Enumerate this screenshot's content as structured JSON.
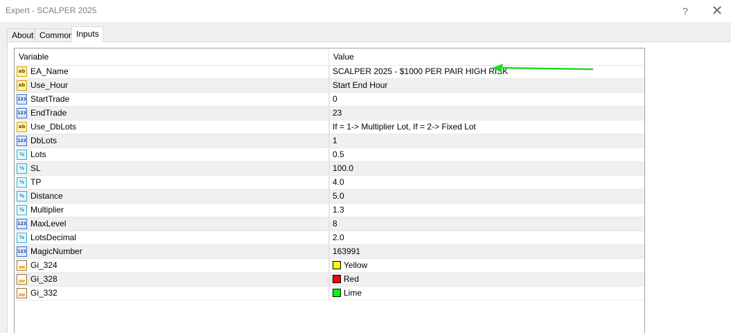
{
  "window": {
    "title": "Expert - SCALPER 2025",
    "help_label": "?",
    "close_label": "✕"
  },
  "tabs": [
    {
      "label": "About"
    },
    {
      "label": "Common"
    },
    {
      "label": "Inputs"
    }
  ],
  "grid": {
    "headers": {
      "variable": "Variable",
      "value": "Value"
    },
    "rows": [
      {
        "icon": "ab",
        "variable": "EA_Name",
        "value": "SCALPER 2025 - $1000 PER PAIR HIGH RISK"
      },
      {
        "icon": "ab",
        "variable": "Use_Hour",
        "value": "Start End Hour"
      },
      {
        "icon": "123",
        "variable": "StartTrade",
        "value": "0"
      },
      {
        "icon": "123",
        "variable": "EndTrade",
        "value": "23"
      },
      {
        "icon": "ab",
        "variable": "Use_DbLots",
        "value": "If = 1-> Multiplier Lot, If = 2-> Fixed Lot"
      },
      {
        "icon": "123",
        "variable": "DbLots",
        "value": "1"
      },
      {
        "icon": "1/2",
        "variable": "Lots",
        "value": "0.5"
      },
      {
        "icon": "1/2",
        "variable": "SL",
        "value": "100.0"
      },
      {
        "icon": "1/2",
        "variable": "TP",
        "value": "4.0"
      },
      {
        "icon": "1/2",
        "variable": "Distance",
        "value": "5.0"
      },
      {
        "icon": "1/2",
        "variable": "Multiplier",
        "value": "1.3"
      },
      {
        "icon": "123",
        "variable": "MaxLevel",
        "value": "8"
      },
      {
        "icon": "1/2",
        "variable": "LotsDecimal",
        "value": "2.0"
      },
      {
        "icon": "123",
        "variable": "MagicNumber",
        "value": "163991"
      },
      {
        "icon": "color",
        "variable": "Gi_324",
        "value": "Yellow",
        "swatch": "#ffff00"
      },
      {
        "icon": "color",
        "variable": "Gi_328",
        "value": "Red",
        "swatch": "#ff0000"
      },
      {
        "icon": "color",
        "variable": "Gi_332",
        "value": "Lime",
        "swatch": "#00ff00"
      }
    ]
  },
  "colors": {
    "arrow": "#22dd22",
    "alt_row": "#f0f0f0"
  }
}
